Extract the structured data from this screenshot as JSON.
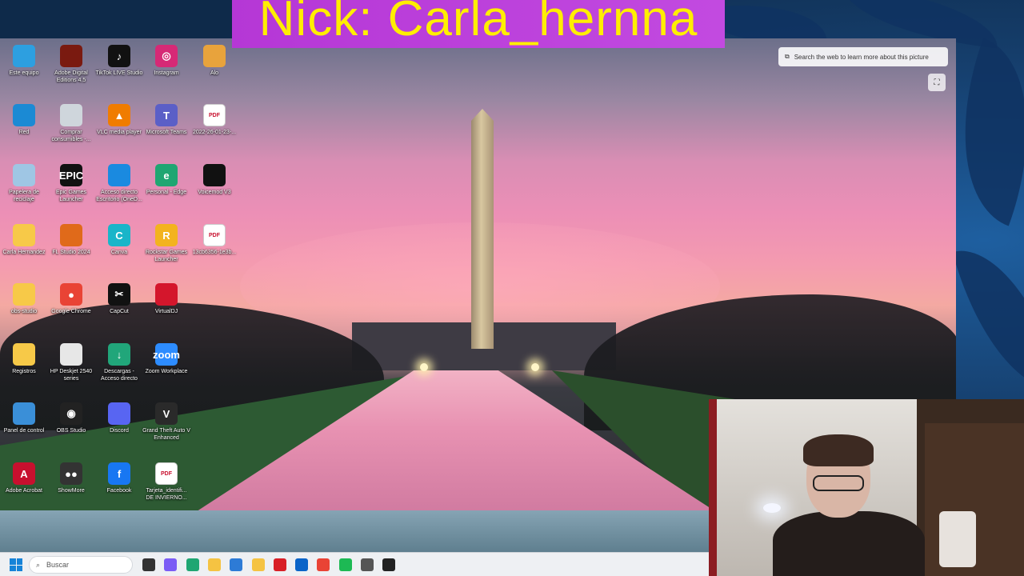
{
  "banner": {
    "nick_text": "Nick: Carla_hernna"
  },
  "web_search": {
    "label": "Search the web to learn more about this picture"
  },
  "desktop_icons": [
    {
      "label": "Este equipo",
      "color": "#2d9fe0",
      "glyph": ""
    },
    {
      "label": "Adobe Digital Editions 4.5",
      "color": "#7a1a10",
      "glyph": ""
    },
    {
      "label": "TikTok LIVE Studio",
      "color": "#111111",
      "glyph": "♪"
    },
    {
      "label": "Instagram",
      "color": "#d62976",
      "glyph": "◎"
    },
    {
      "label": "Alo",
      "color": "#e8a33c",
      "glyph": ""
    },
    {
      "label": "Red",
      "color": "#1b8ad4",
      "glyph": ""
    },
    {
      "label": "Comprar consumibles -...",
      "color": "#cfd6dc",
      "glyph": ""
    },
    {
      "label": "VLC media player",
      "color": "#f07c00",
      "glyph": "▲"
    },
    {
      "label": "Microsoft Teams",
      "color": "#5b5fc7",
      "glyph": "T"
    },
    {
      "label": "2022-26-01-23-...",
      "color": "#ffffff",
      "glyph": "PDF"
    },
    {
      "label": "Papelera de reciclaje",
      "color": "#9fc6e4",
      "glyph": ""
    },
    {
      "label": "Epic Games Launcher",
      "color": "#111111",
      "glyph": "EPIC"
    },
    {
      "label": "Acceso directo Escritorio (OneD...",
      "color": "#1a8ae0",
      "glyph": ""
    },
    {
      "label": "Personal - Edge",
      "color": "#1fa672",
      "glyph": "e"
    },
    {
      "label": "Voicemod V3",
      "color": "#111111",
      "glyph": ""
    },
    {
      "label": "Carla Hernandez",
      "color": "#f7c948",
      "glyph": ""
    },
    {
      "label": "FL Studio 2024",
      "color": "#e06a1a",
      "glyph": ""
    },
    {
      "label": "Canva",
      "color": "#19b5c9",
      "glyph": "C"
    },
    {
      "label": "Rockstar Games Launcher",
      "color": "#f3b31e",
      "glyph": "R"
    },
    {
      "label": "13cb6356-1e3b...",
      "color": "#ffffff",
      "glyph": "PDF"
    },
    {
      "label": "obs-studio",
      "color": "#f7c948",
      "glyph": ""
    },
    {
      "label": "Google Chrome",
      "color": "#e94335",
      "glyph": "●"
    },
    {
      "label": "CapCut",
      "color": "#111111",
      "glyph": "✂"
    },
    {
      "label": "VirtualDJ",
      "color": "#d4162c",
      "glyph": ""
    },
    {
      "label": "",
      "color": "",
      "glyph": ""
    },
    {
      "label": "Registros",
      "color": "#f7c948",
      "glyph": ""
    },
    {
      "label": "HP Deskjet 2540 series",
      "color": "#e7e7e7",
      "glyph": ""
    },
    {
      "label": "Descargas - Acceso directo",
      "color": "#21a67a",
      "glyph": "↓"
    },
    {
      "label": "Zoom Workplace",
      "color": "#2d8cff",
      "glyph": "zoom"
    },
    {
      "label": "",
      "color": "",
      "glyph": ""
    },
    {
      "label": "Panel de control",
      "color": "#3a8fd8",
      "glyph": ""
    },
    {
      "label": "OBS Studio",
      "color": "#222222",
      "glyph": "◉"
    },
    {
      "label": "Discord",
      "color": "#5865f2",
      "glyph": ""
    },
    {
      "label": "Grand Theft Auto V Enhanced",
      "color": "#2a2a2a",
      "glyph": "V"
    },
    {
      "label": "",
      "color": "",
      "glyph": ""
    },
    {
      "label": "Adobe Acrobat",
      "color": "#c8102e",
      "glyph": "A"
    },
    {
      "label": "ShowMore",
      "color": "#333333",
      "glyph": "●●"
    },
    {
      "label": "Facebook",
      "color": "#1877f2",
      "glyph": "f"
    },
    {
      "label": "Tarjeta_identifi... DE INVIERNO...",
      "color": "#ffffff",
      "glyph": "PDF"
    }
  ],
  "taskbar": {
    "search_placeholder": "Buscar",
    "apps": [
      {
        "name": "task-view",
        "color": "#333333"
      },
      {
        "name": "copilot",
        "color": "#7b5cf5"
      },
      {
        "name": "edge",
        "color": "#1fa672"
      },
      {
        "name": "file-explorer",
        "color": "#f5c342"
      },
      {
        "name": "microsoft-store",
        "color": "#2d7bd6"
      },
      {
        "name": "sticky-folder",
        "color": "#f5c342"
      },
      {
        "name": "netflix",
        "color": "#d81f26"
      },
      {
        "name": "outlook",
        "color": "#0a64c8"
      },
      {
        "name": "chrome",
        "color": "#e94335"
      },
      {
        "name": "spotify",
        "color": "#1db954"
      },
      {
        "name": "camera",
        "color": "#555555"
      },
      {
        "name": "obs",
        "color": "#222222"
      }
    ]
  }
}
